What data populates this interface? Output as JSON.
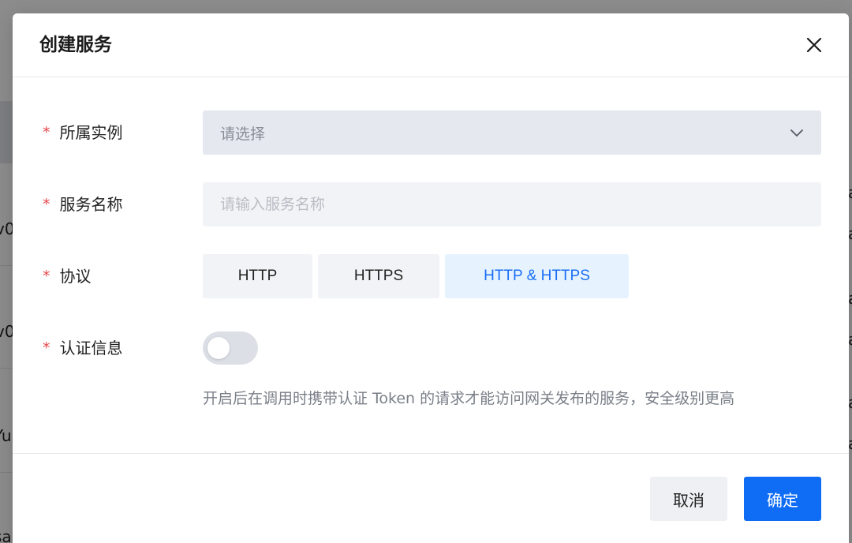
{
  "background": {
    "fragments": [
      "v0",
      "v0",
      "Yu",
      "sa"
    ],
    "right_fragments": [
      "a",
      "a",
      "a",
      "a",
      "a",
      "a"
    ]
  },
  "dialog": {
    "title": "创建服务",
    "close_icon": "close-icon",
    "fields": {
      "instance": {
        "label": "所属实例",
        "placeholder": "请选择"
      },
      "service_name": {
        "label": "服务名称",
        "placeholder": "请输入服务名称",
        "value": ""
      },
      "protocol": {
        "label": "协议",
        "options": [
          "HTTP",
          "HTTPS",
          "HTTP & HTTPS"
        ],
        "selected": "HTTP & HTTPS"
      },
      "auth": {
        "label": "认证信息",
        "enabled": false,
        "help": "开启后在调用时携带认证 Token 的请求才能访问网关发布的服务，安全级别更高"
      }
    },
    "required_mark": "*",
    "buttons": {
      "cancel": "取消",
      "ok": "确定"
    }
  },
  "colors": {
    "primary": "#0f6cf5",
    "selected_option_bg": "#e6f3ff",
    "selected_option_text": "#1a6ef3",
    "required": "#e5484d",
    "mask": "rgba(0,0,0,0.45)"
  }
}
